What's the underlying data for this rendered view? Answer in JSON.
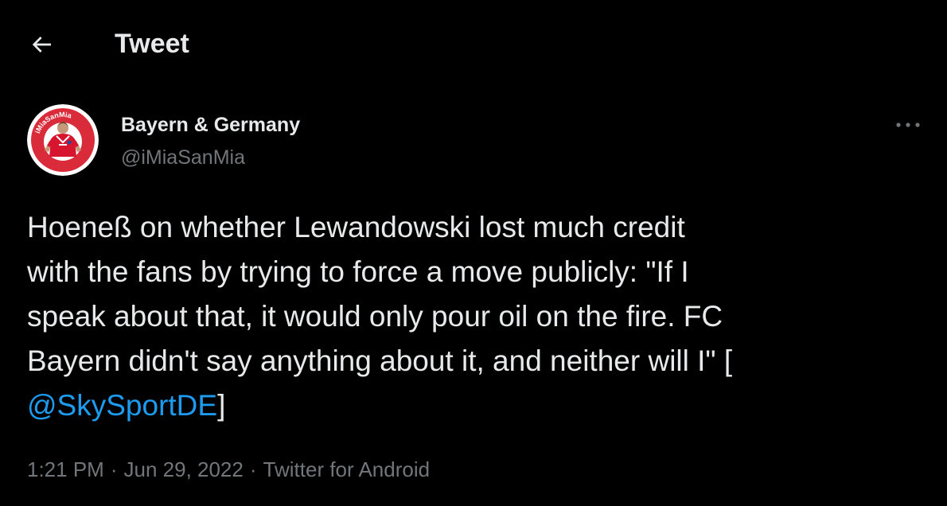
{
  "header": {
    "back_icon": "arrow-left-icon",
    "title": "Tweet"
  },
  "author": {
    "display_name": "Bayern & Germany",
    "handle": "@iMiaSanMia",
    "avatar_text": "iMiaSanMia",
    "avatar_colors": {
      "ring": "#d92b3a",
      "inner": "#ffffff",
      "jersey": "#d7152e"
    }
  },
  "more_icon": "more-horizontal-icon",
  "tweet": {
    "line1": "Hoeneß on whether Lewandowski lost much credit",
    "line2": "with the fans by trying to force a move publicly: \"If I",
    "line3": "speak about that, it would only pour oil on the fire. FC",
    "line4": "Bayern didn't say anything about it, and neither will I\" [",
    "mention": "@SkySportDE",
    "close_bracket": "]"
  },
  "meta": {
    "time": "1:21 PM",
    "separator": "·",
    "date": "Jun 29, 2022",
    "source": "Twitter for Android"
  },
  "colors": {
    "background": "#000000",
    "text": "#e7e9ea",
    "secondary": "#71767b",
    "link": "#1d9bf0"
  }
}
